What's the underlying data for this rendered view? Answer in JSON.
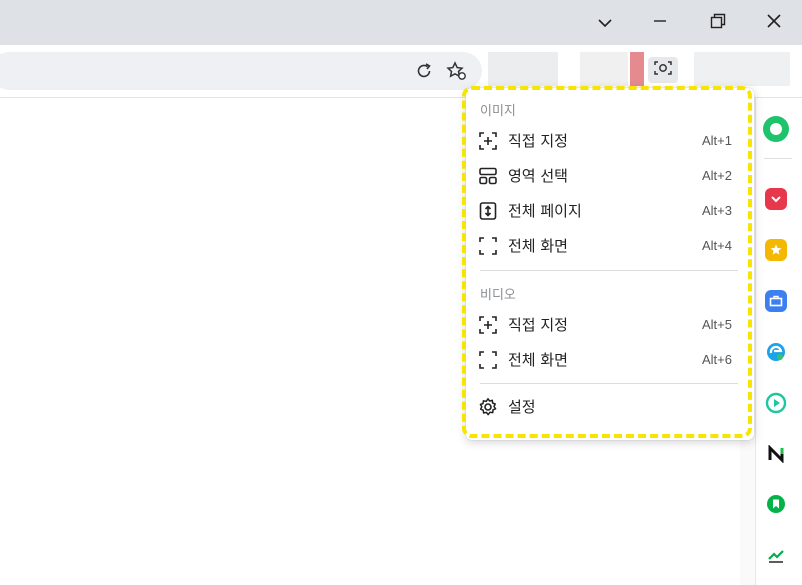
{
  "window": {
    "buttons": [
      "tab-list",
      "minimize",
      "restore",
      "close"
    ]
  },
  "toolbar": {
    "icons": [
      "reload-icon",
      "favorite-icon",
      "screenshot-icon"
    ]
  },
  "menu": {
    "sections": [
      {
        "title": "이미지",
        "items": [
          {
            "label": "직접 지정",
            "shortcut": "Alt+1",
            "icon": "select-area-icon"
          },
          {
            "label": "영역 선택",
            "shortcut": "Alt+2",
            "icon": "region-icon"
          },
          {
            "label": "전체 페이지",
            "shortcut": "Alt+3",
            "icon": "full-page-icon"
          },
          {
            "label": "전체 화면",
            "shortcut": "Alt+4",
            "icon": "full-screen-icon"
          }
        ]
      },
      {
        "title": "비디오",
        "items": [
          {
            "label": "직접 지정",
            "shortcut": "Alt+5",
            "icon": "select-area-icon"
          },
          {
            "label": "전체 화면",
            "shortcut": "Alt+6",
            "icon": "full-screen-icon"
          }
        ]
      }
    ],
    "settings_label": "설정"
  },
  "sidebar": {
    "icons": [
      "green-circle-icon",
      "pocket-icon",
      "star-icon",
      "toolbox-icon",
      "edge-icon",
      "play-icon",
      "n-icon",
      "bookmark-icon",
      "chart-icon"
    ]
  },
  "colors": {
    "highlight": "#f7e400",
    "titlebar": "#dee1e6"
  }
}
